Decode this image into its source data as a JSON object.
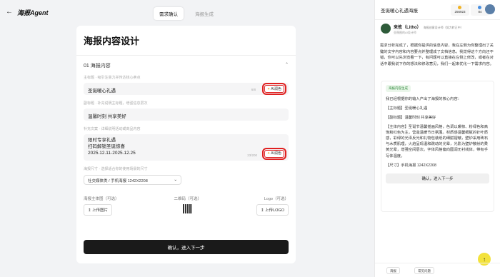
{
  "header": {
    "back_icon": "arrow-left-icon",
    "logo": "海报Agent",
    "steps": [
      {
        "label": "需求确认",
        "active": true
      },
      {
        "label": "海报生成",
        "active": false
      }
    ]
  },
  "form": {
    "title": "海报内容设计",
    "section": "01 海报内容",
    "main_title": {
      "hint": "主标题 · 吸引注意力并传达核心卖点",
      "value": "圣诞暖心礼遇",
      "counter": "6/8"
    },
    "subtitle": {
      "hint": "副标题 · 补充说明主标题，增强信息层次",
      "value": "温馨时刻 共享美好"
    },
    "copy": {
      "hint": "补充文案 · 详细说明活动或商品内容",
      "lines": [
        "限时专享礼遇",
        "扫码解锁圣诞惊喜",
        "2025.12.11-2025.12.25"
      ],
      "counter": "23/200"
    },
    "ai_button": "AI润色",
    "size": {
      "hint": "海报尺寸 · 选择适合你的使用场景的尺寸",
      "value": "社交媒体类 / 手机海报 1242X2208"
    },
    "uploads": [
      {
        "label": "海报主体图（可选）",
        "button": "上传图片"
      },
      {
        "label": "二维码（可选）"
      },
      {
        "label": "Logo（可选）",
        "button": "上传LOGO"
      }
    ],
    "confirm": "确认，进入下一步"
  },
  "panel": {
    "title": "圣诞暖心礼遇海报",
    "stats": [
      "256923",
      "84"
    ],
    "agent": {
      "name": "来攸（Litho）",
      "tag": "海报创意设计师（努力转正中）",
      "sub": "亚薇图的AI设计师"
    },
    "intro": "需求分析完成了，根据你提供的信息内容，我在左侧为你整理出了关键的文字内容和内容要点并整理成了文档信息。我觉得这个方向还不错，你可以先浏览看一下，有问题可以直接在左侧上修改，或者在对话中跟我说下你的想法和修改意见，我们一起来优化一下需求内容。",
    "result": {
      "badge": "海报内容生成",
      "lead": "我已经根据你的输入产出了海报的核心内容：",
      "main": "【主标题】圣诞暖心礼遇",
      "sub": "【副标题】温馨时刻 共享美好",
      "body": "【主体内容】圣诞节温馨插画风格，色调以暖棕、粉绿色和高饱和红色为主，营造温暖节日氛围。材质感温馨细腻的针叶质感，彩绿的光泽反光和礼物包装纸的细腻褶皱，壁炉采用砖石与木质肌理，火焰呈现温和跳动的光晕，光影为壁炉散射的柔黄光晕，增强空间层次。字体风格偏向圆润无衬线体，带有手写体温度。",
      "size": "【尺寸】手机海报 1242X2208",
      "button": "确认，进入下一步"
    },
    "chips": [
      "海报",
      "常见问题"
    ]
  }
}
